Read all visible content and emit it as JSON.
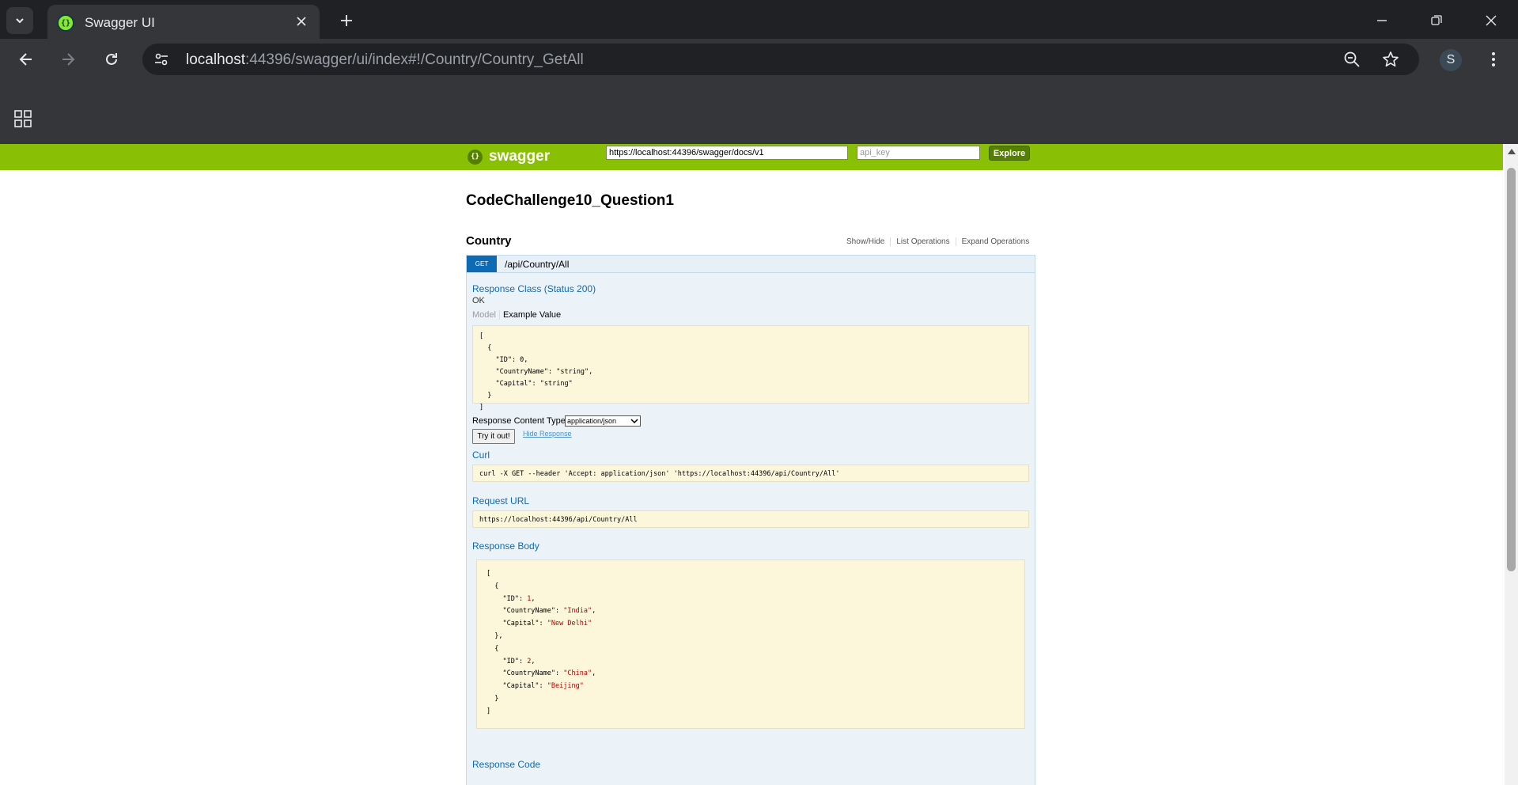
{
  "browser": {
    "tab_title": "Swagger UI",
    "url_host": "localhost",
    "url_rest": ":44396/swagger/ui/index#!/Country/Country_GetAll",
    "profile_initial": "S"
  },
  "swagger": {
    "logo_text": "swagger",
    "spec_url": "https://localhost:44396/swagger/docs/v1",
    "api_key_placeholder": "api_key",
    "explore_label": "Explore",
    "api_title": "CodeChallenge10_Question1",
    "resource": {
      "name": "Country",
      "links": [
        "Show/Hide",
        "List Operations",
        "Expand Operations"
      ]
    },
    "operation": {
      "method": "GET",
      "path": "/api/Country/All",
      "response_class_title": "Response Class (Status 200)",
      "response_class_desc": "OK",
      "model_tab": "Model",
      "example_tab": "Example Value",
      "example_value": "[\n  {\n    \"ID\": 0,\n    \"CountryName\": \"string\",\n    \"Capital\": \"string\"\n  }\n]",
      "content_type_label": "Response Content Type",
      "content_type_value": "application/json",
      "try_button": "Try it out!",
      "hide_response": "Hide Response",
      "curl_title": "Curl",
      "curl_command": "curl -X GET --header 'Accept: application/json' 'https://localhost:44396/api/Country/All'",
      "request_url_title": "Request URL",
      "request_url": "https://localhost:44396/api/Country/All",
      "response_body_title": "Response Body",
      "response_body": [
        {
          "ID": 1,
          "CountryName": "India",
          "Capital": "New Delhi"
        },
        {
          "ID": 2,
          "CountryName": "China",
          "Capital": "Beijing"
        }
      ],
      "response_code_title": "Response Code"
    }
  },
  "colors": {
    "swagger_green": "#89bf04",
    "get_blue": "#0f6ab4",
    "code_bg": "#fcf6db",
    "op_bg": "#ebf3f9"
  }
}
